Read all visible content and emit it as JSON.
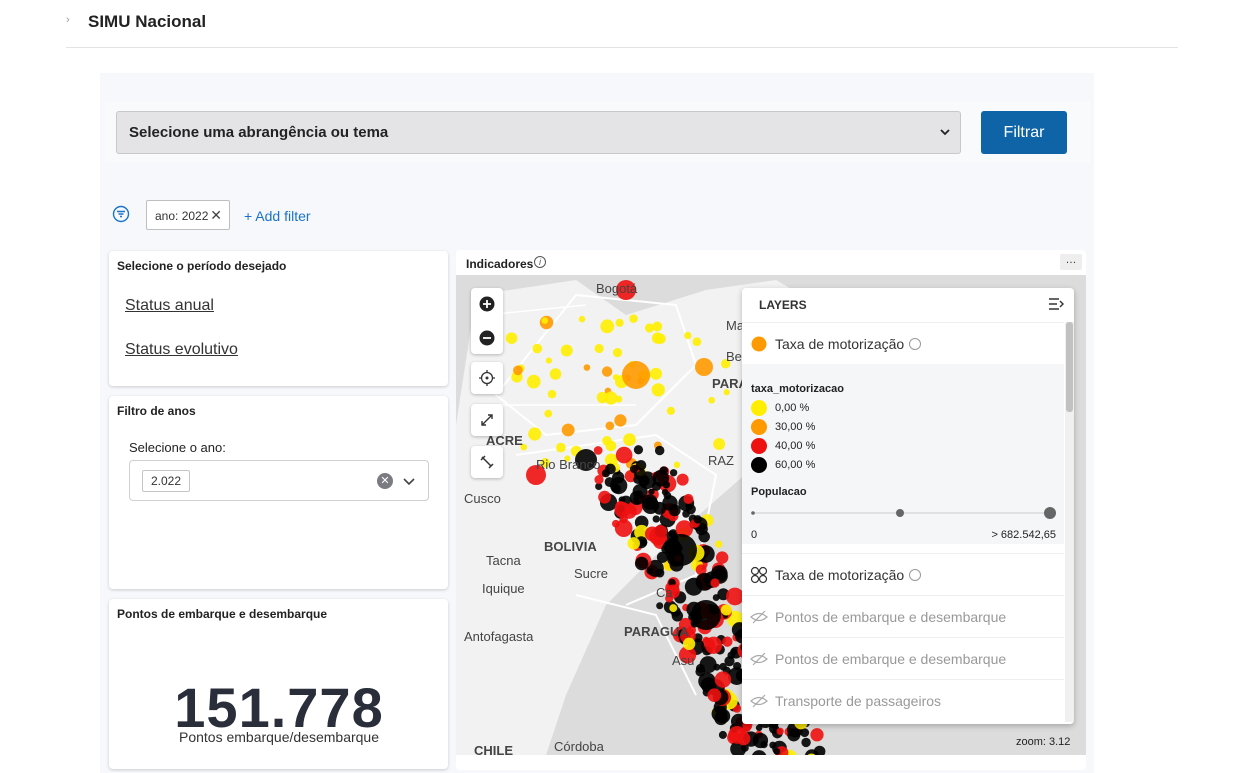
{
  "header": {
    "title": "SIMU Nacional",
    "chevron": "›"
  },
  "toolbar": {
    "select_label": "Selecione uma abrangência ou tema",
    "filter_button": "Filtrar"
  },
  "filters": {
    "chip": "ano: 2022",
    "chip_close": "✕",
    "add_filter": "+ Add filter"
  },
  "period_card": {
    "title": "Selecione o período desejado",
    "links": [
      "Status anual",
      "Status evolutivo"
    ]
  },
  "year_card": {
    "title": "Filtro de anos",
    "label": "Selecione o ano:",
    "value": "2.022",
    "clear": "✕"
  },
  "stops_card": {
    "title": "Pontos de embarque e desembarque",
    "value": "151.778",
    "subtitle": "Pontos embarque/desembarque"
  },
  "map_panel": {
    "title": "Indicadores",
    "info": "i",
    "more": "…",
    "zoom_label": "zoom: 3.12",
    "place_labels": [
      "Bogotá",
      "Cusco",
      "BOLIVIA",
      "Tacna",
      "Sucre",
      "Iquique",
      "Antofagasta",
      "PARAGUA",
      "Asu",
      "Córdoba",
      "CHILE",
      "Rio Branco",
      "ACRE",
      "Ma",
      "Belém",
      "PARÁ",
      "RAZ",
      "Ca"
    ]
  },
  "layers": {
    "title": "LAYERS",
    "active_layer": "Taxa de motorização",
    "legend_title": "taxa_motorizacao",
    "legend_items": [
      {
        "color": "#ffee00",
        "label": "0,00 %"
      },
      {
        "color": "#ff9900",
        "label": "30,00 %"
      },
      {
        "color": "#ee1111",
        "label": "40,00 %"
      },
      {
        "color": "#000000",
        "label": "60,00 %"
      }
    ],
    "size_title": "Populacao",
    "size_min": "0",
    "size_max": "> 682.542,65",
    "other_layers": [
      {
        "name": "Taxa de motorização",
        "visible": true
      },
      {
        "name": "Pontos de embarque e desembarque",
        "visible": false
      },
      {
        "name": "Pontos de embarque e desembarque",
        "visible": false
      },
      {
        "name": "Transporte de passageiros",
        "visible": false
      }
    ]
  },
  "colors": {
    "accent": "#0f64a8",
    "link": "#1a73c8"
  }
}
